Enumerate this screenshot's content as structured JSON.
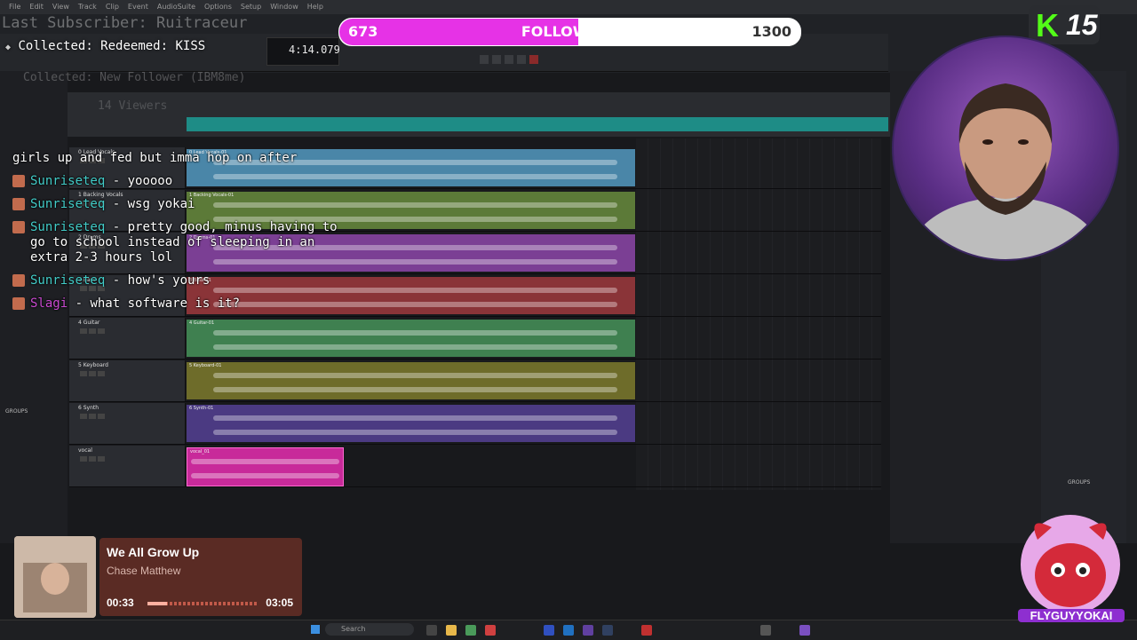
{
  "overlay": {
    "last_subscriber": "Last Subscriber: Ruitraceur",
    "collected_redeemed": "Collected: Redeemed: KISS",
    "collected_follower": "Collected: New Follower (IBM8me)",
    "viewers": "14 Viewers",
    "followers": {
      "current": "673",
      "label": "FOLLOWERS",
      "goal": "1300",
      "progress": 0.5177
    },
    "kick_count": "15",
    "mascot_name": "FLYGUYYOKAI"
  },
  "daw": {
    "menu": [
      "File",
      "Edit",
      "View",
      "Track",
      "Clip",
      "Event",
      "AudioSuite",
      "Options",
      "Setup",
      "Window",
      "Help"
    ],
    "counter": "4:14.079",
    "tracks": [
      {
        "name": "0 Lead Vocals",
        "clip": "0 Lead Vocals-01",
        "color": "#4a86a8"
      },
      {
        "name": "1 Backing Vocals",
        "clip": "1 Backing Vocals-01",
        "color": "#5c7a38"
      },
      {
        "name": "2 Drums",
        "clip": "2 Drums-01",
        "color": "#7b3f94"
      },
      {
        "name": "3 Bass",
        "clip": "3 Bass-01",
        "color": "#8a3438"
      },
      {
        "name": "4 Guitar",
        "clip": "4 Guitar-01",
        "color": "#3f8050"
      },
      {
        "name": "5 Keyboard",
        "clip": "5 Keyboard-01",
        "color": "#6e6c2a"
      },
      {
        "name": "6 Synth",
        "clip": "6 Synth-01",
        "color": "#4b3a82"
      },
      {
        "name": "vocal",
        "clip": "vocal_01",
        "color": "#c82a9a"
      }
    ],
    "groups_label": "GROUPS"
  },
  "chat": [
    {
      "user": "",
      "text": "girls up and fed but imma hop on after"
    },
    {
      "user": "Sunriseteq",
      "text": "- yooooo"
    },
    {
      "user": "Sunriseteq",
      "text": "- wsg yokai"
    },
    {
      "user": "Sunriseteq",
      "text": "- pretty good, minus having to go to school instead of sleeping in an extra 2-3 hours lol"
    },
    {
      "user": "Sunriseteq",
      "text": "- how's yours"
    },
    {
      "user": "Slagi",
      "text": "- what software is it?"
    }
  ],
  "now_playing": {
    "title": "We All Grow Up",
    "artist": "Chase Matthew",
    "current": "00:33",
    "duration": "03:05",
    "progress": 0.178
  },
  "taskbar": {
    "search": "Search"
  }
}
